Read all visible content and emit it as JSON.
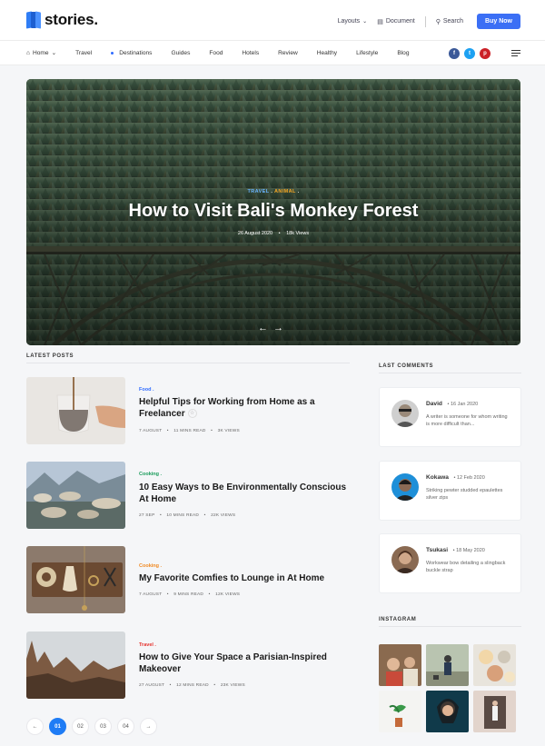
{
  "header": {
    "logo_text": "stories.",
    "layouts_label": "Layouts",
    "document_label": "Document",
    "search_label": "Search",
    "buy_label": "Buy Now"
  },
  "nav": {
    "items": [
      "Home",
      "Travel",
      "Destinations",
      "Guides",
      "Food",
      "Hotels",
      "Review",
      "Healthy",
      "Lifestyle",
      "Blog"
    ],
    "social": [
      "f",
      "t",
      "p"
    ]
  },
  "hero": {
    "cat1": "TRAVEL",
    "cat2": "ANIMAL",
    "title": "How to Visit Bali's Monkey Forest",
    "date": "26 August 2020",
    "views": "18k Views",
    "arrows": "← →"
  },
  "latest": {
    "title": "LATEST POSTS",
    "posts": [
      {
        "category": "Food",
        "title": "Helpful Tips for Working from Home as a Freelancer",
        "date": "7 AUGUST",
        "read": "11 MINS READ",
        "views": "3K VIEWS",
        "cat_color": "#2f6bff"
      },
      {
        "category": "Cooking",
        "title": "10 Easy Ways to Be Environmentally Conscious At Home",
        "date": "27 SEP",
        "read": "10 MINS READ",
        "views": "22K VIEWS",
        "cat_color": "#1a9c5b"
      },
      {
        "category": "Cooking",
        "title": "My Favorite Comfies to Lounge in At Home",
        "date": "7 AUGUST",
        "read": "9 MINS READ",
        "views": "12K VIEWS",
        "cat_color": "#f08a24"
      },
      {
        "category": "Travel",
        "title": "How to Give Your Space a Parisian-Inspired Makeover",
        "date": "27 AUGUST",
        "read": "12 MINS READ",
        "views": "23K VIEWS",
        "cat_color": "#e5322d"
      }
    ]
  },
  "pagination": {
    "prev": "←",
    "pages": [
      "01",
      "02",
      "03",
      "04"
    ],
    "next": "→",
    "active": "01"
  },
  "sidebar": {
    "comments_title": "LAST COMMENTS",
    "comments": [
      {
        "name": "David",
        "date": "16 Jan 2020",
        "text": "A writer is someone for whom writing is more difficult than..."
      },
      {
        "name": "Kokawa",
        "date": "12 Feb 2020",
        "text": "Striking pewter studded epaulettes silver zips"
      },
      {
        "name": "Tsukasi",
        "date": "18 May 2020",
        "text": "Workwear bow detailing a slingback buckle strap"
      }
    ],
    "instagram_title": "INSTAGRAM"
  }
}
